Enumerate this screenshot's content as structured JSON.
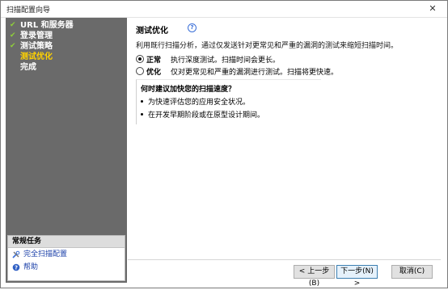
{
  "window": {
    "title": "扫描配置向导",
    "close_glyph": "✕"
  },
  "sidebar": {
    "steps": [
      {
        "label": "URL 和服务器",
        "done": true
      },
      {
        "label": "登录管理",
        "done": true
      },
      {
        "label": "测试策略",
        "done": true
      },
      {
        "label": "测试优化",
        "done": false,
        "active": true
      },
      {
        "label": "完成",
        "done": false
      }
    ],
    "check_glyph": "✔"
  },
  "tasks": {
    "header": "常规任务",
    "links": [
      {
        "label": "完全扫描配置",
        "icon": "wrench-icon"
      },
      {
        "label": "帮助",
        "icon": "help-icon"
      }
    ]
  },
  "main": {
    "heading": "测试优化",
    "help_glyph": "?",
    "description": "利用既行扫描分析，通过仅发送针对更常见和严重的漏洞的测试来缩短扫描时间。",
    "options": [
      {
        "label": "正常",
        "text": "执行深度测试。扫描时间会更长。",
        "selected": true
      },
      {
        "label": "优化",
        "text": "仅对更常见和严重的漏洞进行测试。扫描将更快速。",
        "selected": false
      }
    ],
    "info": {
      "title": "何时建议加快您的扫描速度？",
      "bullets": [
        "为快速评估您的应用安全状况。",
        "在开发早期阶段或在原型设计期间。"
      ]
    }
  },
  "footer": {
    "back": "< 上一步(B)",
    "next": "下一步(N) >",
    "cancel": "取消(C)"
  },
  "colors": {
    "sidebar_bg": "#6a6a6a",
    "active_step": "#ffd200",
    "check": "#8fcf3a",
    "link": "#1a3fa8"
  }
}
